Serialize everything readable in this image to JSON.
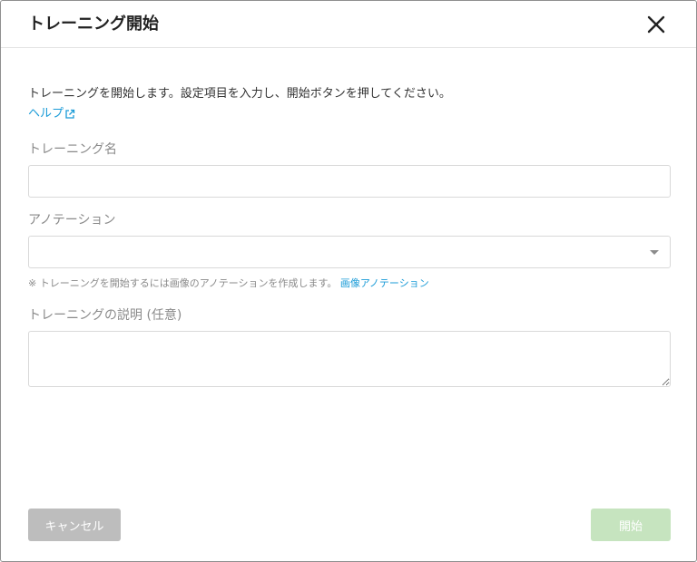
{
  "dialog": {
    "title": "トレーニング開始",
    "intro": "トレーニングを開始します。設定項目を入力し、開始ボタンを押してください。",
    "help_link": "ヘルプ"
  },
  "form": {
    "name": {
      "label": "トレーニング名",
      "value": ""
    },
    "annotation": {
      "label": "アノテーション",
      "selected": ""
    },
    "note": {
      "text": "※ トレーニングを開始するには画像のアノテーションを作成します。",
      "link": "画像アノテーション"
    },
    "description": {
      "label": "トレーニングの説明 (任意)",
      "value": ""
    }
  },
  "footer": {
    "cancel_label": "キャンセル",
    "start_label": "開始"
  },
  "colors": {
    "link": "#1a9bd7",
    "cancel_button": "#bdbdbd",
    "start_button": "#c6e4bf"
  },
  "icons": {
    "close": "close-icon",
    "external_link": "external-link-icon",
    "dropdown": "chevron-down-icon"
  }
}
